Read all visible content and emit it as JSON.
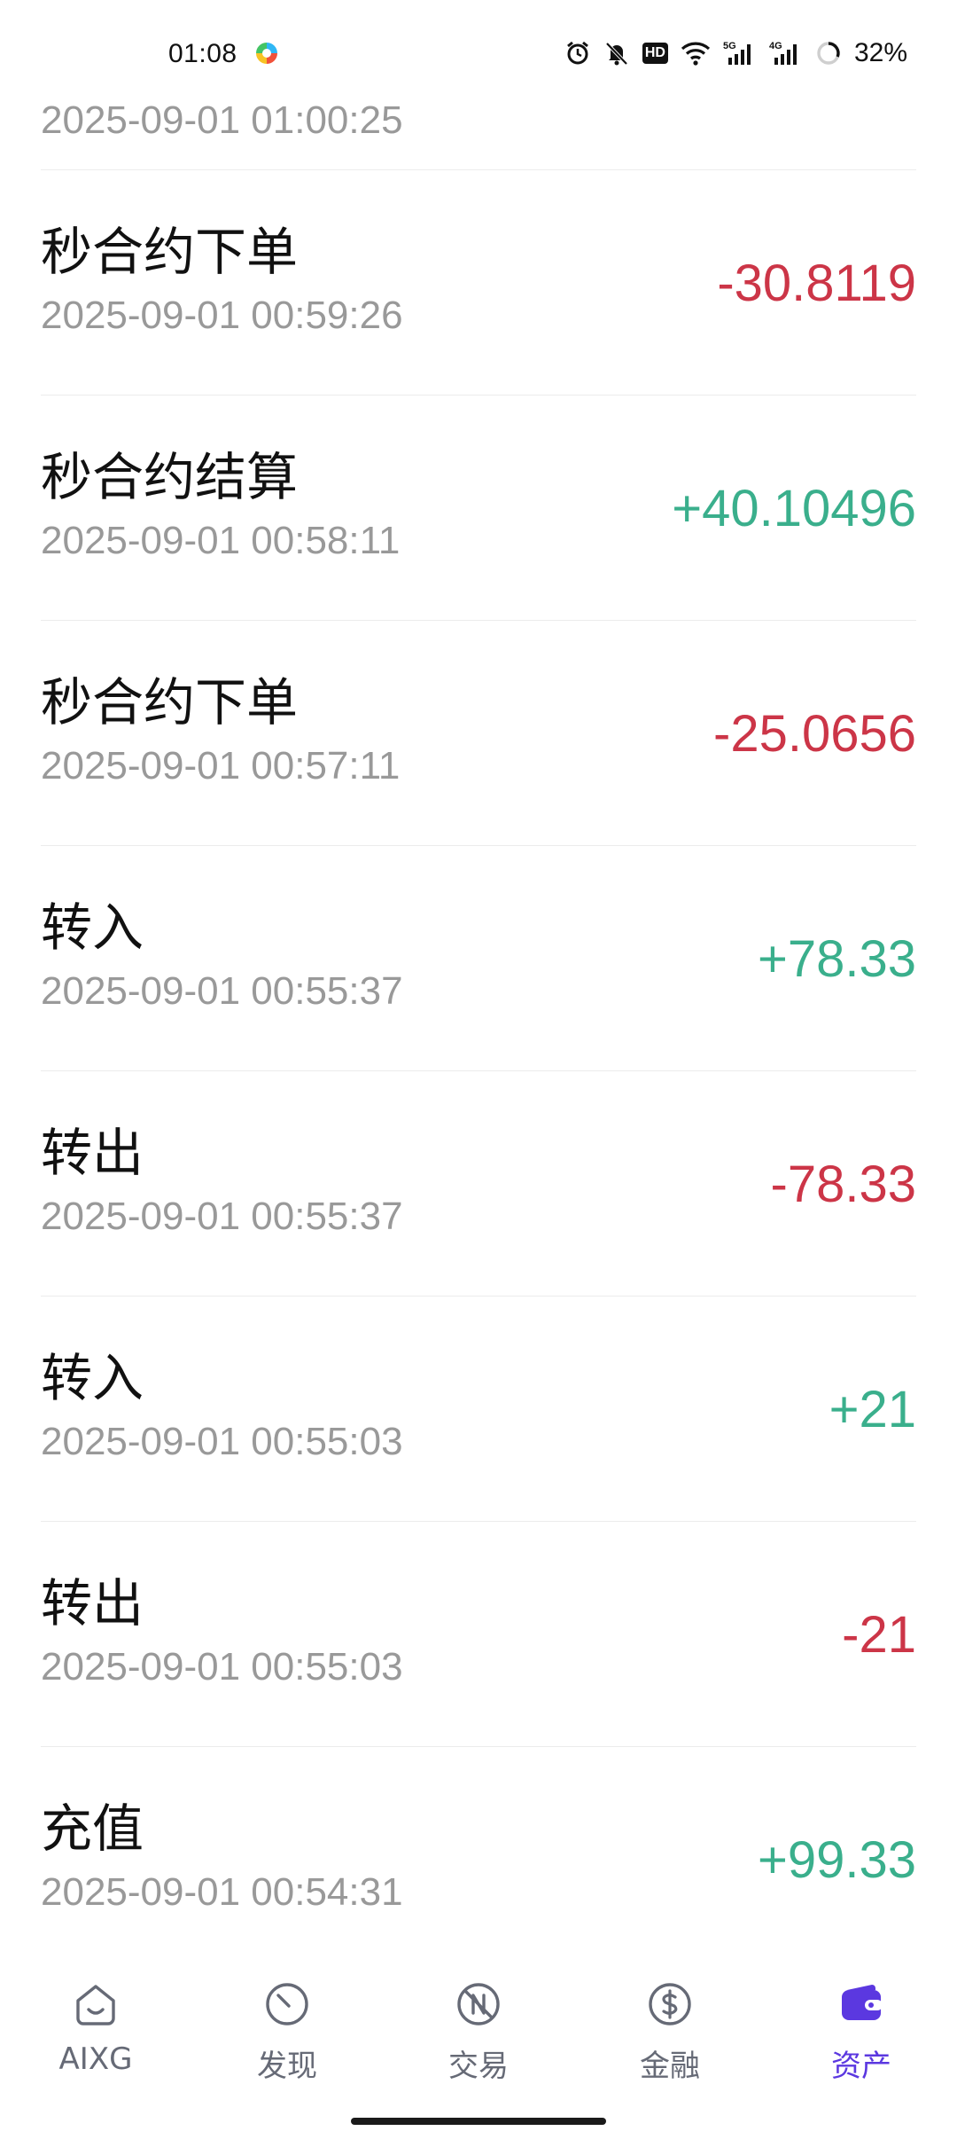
{
  "status_bar": {
    "time": "01:08",
    "battery": "32%",
    "hd_label": "HD",
    "network_5g": "5G",
    "network_4g": "4G"
  },
  "records": [
    {
      "type": "",
      "time": "2025-09-01 01:00:25",
      "amount": "",
      "sign": "none"
    },
    {
      "type": "秒合约下单",
      "time": "2025-09-01 00:59:26",
      "amount": "-30.8119",
      "sign": "negative"
    },
    {
      "type": "秒合约结算",
      "time": "2025-09-01 00:58:11",
      "amount": "+40.10496",
      "sign": "positive"
    },
    {
      "type": "秒合约下单",
      "time": "2025-09-01 00:57:11",
      "amount": "-25.0656",
      "sign": "negative"
    },
    {
      "type": "转入",
      "time": "2025-09-01 00:55:37",
      "amount": "+78.33",
      "sign": "positive"
    },
    {
      "type": "转出",
      "time": "2025-09-01 00:55:37",
      "amount": "-78.33",
      "sign": "negative"
    },
    {
      "type": "转入",
      "time": "2025-09-01 00:55:03",
      "amount": "+21",
      "sign": "positive"
    },
    {
      "type": "转出",
      "time": "2025-09-01 00:55:03",
      "amount": "-21",
      "sign": "negative"
    },
    {
      "type": "充值",
      "time": "2025-09-01 00:54:31",
      "amount": "+99.33",
      "sign": "positive"
    }
  ],
  "bottom_nav": {
    "items": [
      {
        "label": "AIXG",
        "icon": "home-icon",
        "active": false
      },
      {
        "label": "发现",
        "icon": "compass-icon",
        "active": false
      },
      {
        "label": "交易",
        "icon": "trade-icon",
        "active": false
      },
      {
        "label": "金融",
        "icon": "dollar-icon",
        "active": false
      },
      {
        "label": "资产",
        "icon": "wallet-icon",
        "active": true
      }
    ]
  },
  "colors": {
    "negative": "#cc3547",
    "positive": "#3aaf8c",
    "active_nav": "#5b38e0",
    "inactive_nav": "#666a76",
    "secondary_text": "#999999"
  }
}
